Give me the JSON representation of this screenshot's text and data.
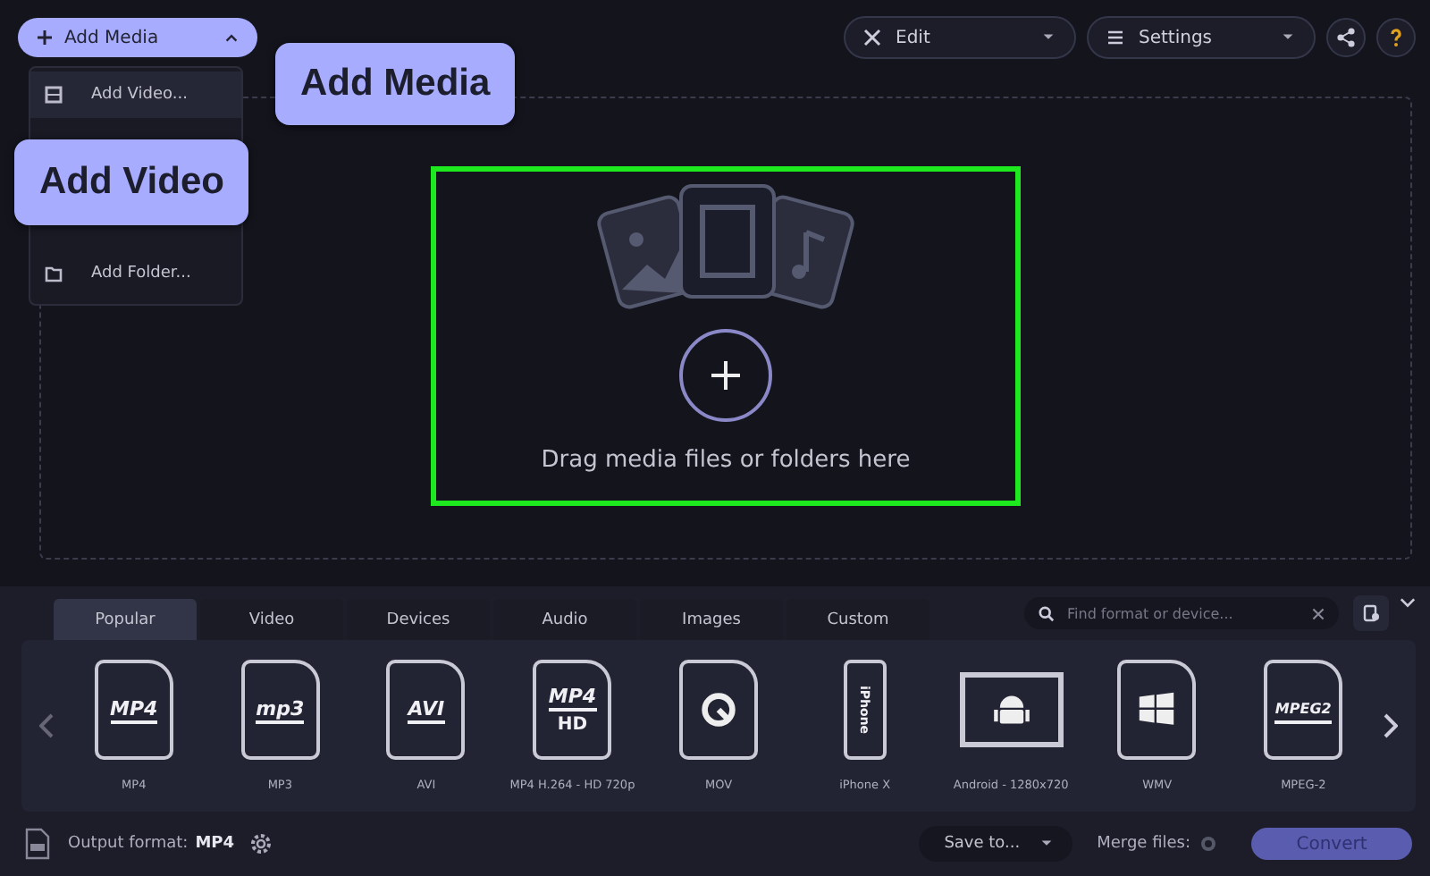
{
  "toolbar": {
    "add_media": {
      "label": "Add Media",
      "expanded": true
    },
    "edit": "Edit",
    "settings": "Settings"
  },
  "add_menu": [
    {
      "label": "Add Video...",
      "kind": "video",
      "selected": true
    },
    {
      "label": "Add Folder...",
      "kind": "folder",
      "selected": false
    }
  ],
  "callouts": [
    "Add Media",
    "Add Video"
  ],
  "drop_zone": {
    "text": "Drag media files or folders here",
    "highlighted": true
  },
  "tabs": [
    {
      "label": "Popular",
      "selected": true
    },
    {
      "label": "Video",
      "selected": false
    },
    {
      "label": "Devices",
      "selected": false
    },
    {
      "label": "Audio",
      "selected": false
    },
    {
      "label": "Images",
      "selected": false
    },
    {
      "label": "Custom",
      "selected": false
    }
  ],
  "search": {
    "placeholder": "Find format or device..."
  },
  "formats": [
    {
      "label": "MP4",
      "kind": "file",
      "badge": "MP4"
    },
    {
      "label": "MP3",
      "kind": "file",
      "badge": "mp3"
    },
    {
      "label": "AVI",
      "kind": "file",
      "badge": "AVI"
    },
    {
      "label": "MP4 H.264 - HD 720p",
      "kind": "file",
      "badge": "MP4",
      "sub": "HD"
    },
    {
      "label": "MOV",
      "kind": "quicktime"
    },
    {
      "label": "iPhone X",
      "kind": "phone",
      "badge": "iPhone"
    },
    {
      "label": "Android - 1280x720",
      "kind": "tablet"
    },
    {
      "label": "WMV",
      "kind": "windows"
    },
    {
      "label": "MPEG-2",
      "kind": "file",
      "badge": "MPEG2"
    }
  ],
  "output": {
    "label": "Output format:",
    "value": "MP4"
  },
  "save_to": "Save to...",
  "merge": {
    "label": "Merge files:",
    "on": false
  },
  "convert": {
    "label": "Convert",
    "disabled": true
  }
}
